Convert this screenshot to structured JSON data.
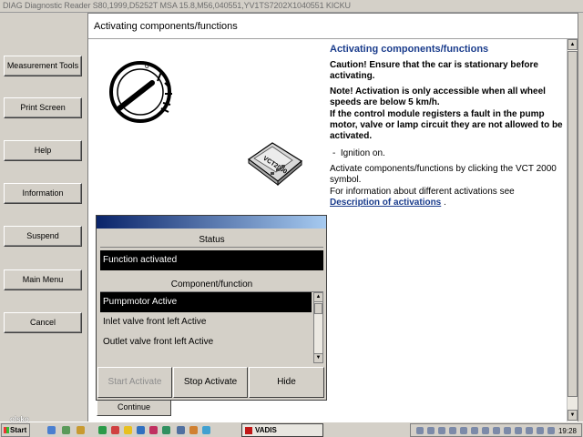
{
  "window": {
    "title": "DIAG Diagnostic Reader S80,1999,D5252T MSA 15.8,M56,040551,YV1TS7202X1040551 KICKU"
  },
  "nav": {
    "measurement_tools": "Measurement Tools",
    "print_screen": "Print Screen",
    "help": "Help",
    "information": "Information",
    "suspend": "Suspend",
    "main_menu": "Main Menu",
    "cancel": "Cancel"
  },
  "page": {
    "header": "Activating components/functions",
    "title": "Activating components/functions",
    "caution": "Caution! Ensure that the car is stationary before activating.",
    "note": "Note! Activation is only accessible when all wheel speeds are below 5  km/h.",
    "fault_text": "If the control module registers a fault in the pump motor, valve or lamp circuit they are not allowed to be activated.",
    "bullet": "Ignition on.",
    "instruction": "Activate components/functions by clicking the VCT 2000 symbol.",
    "info_text": "For information about different activations see",
    "link": "Description of activations",
    "link_suffix": ".",
    "continue": "Continue",
    "vct_label": "VCT2000"
  },
  "dialog": {
    "status_label": "Status",
    "status_value": "Function activated",
    "component_label": "Component/function",
    "items": [
      "Pumpmotor Active",
      "Inlet valve front left Active",
      "Outlet valve front left Active"
    ],
    "selected_index": 0,
    "start_activate": "Start Activate",
    "stop_activate": "Stop Activate",
    "hide": "Hide"
  },
  "taskbar": {
    "start": "Start",
    "vadis": "VADIS",
    "clock": "19:28"
  },
  "watermark": "olsko"
}
